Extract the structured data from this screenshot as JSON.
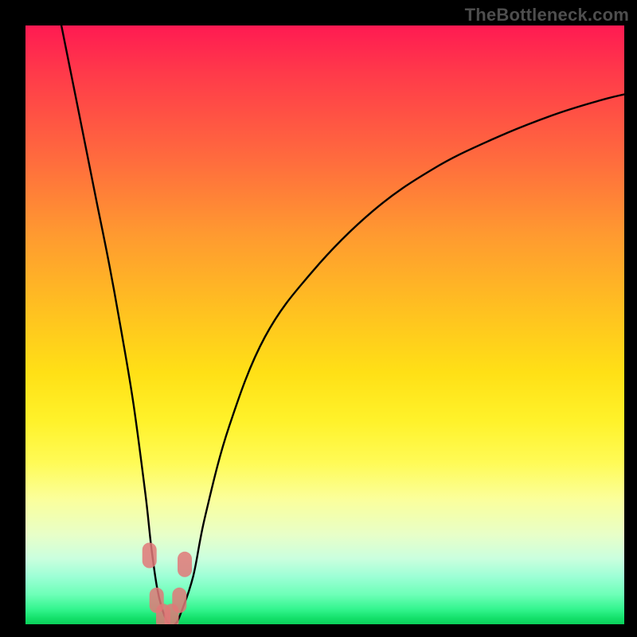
{
  "watermark": "TheBottleneck.com",
  "chart_data": {
    "type": "line",
    "title": "",
    "xlabel": "",
    "ylabel": "",
    "xlim": [
      0,
      100
    ],
    "ylim": [
      0,
      100
    ],
    "grid": false,
    "series": [
      {
        "name": "bottleneck-curve",
        "x": [
          6,
          8,
          10,
          12,
          14,
          16,
          18,
          20,
          21,
          22,
          23,
          24,
          25,
          26,
          28,
          30,
          34,
          40,
          48,
          58,
          68,
          78,
          88,
          96,
          100
        ],
        "values": [
          100,
          90,
          80,
          70,
          60,
          49,
          37,
          22,
          13,
          6,
          2,
          0,
          0,
          2,
          8,
          18,
          33,
          48,
          59,
          69,
          76,
          81,
          85,
          87.5,
          88.5
        ]
      }
    ],
    "marker_points": {
      "x": [
        20.7,
        21.9,
        23.0,
        24.4,
        25.7,
        26.6
      ],
      "values": [
        11.5,
        4.0,
        1.3,
        1.3,
        4.0,
        10.0
      ]
    },
    "gradient_stops": [
      {
        "pos": 0.0,
        "color": "#ff1a52"
      },
      {
        "pos": 0.35,
        "color": "#ff9a30"
      },
      {
        "pos": 0.66,
        "color": "#fff22a"
      },
      {
        "pos": 0.92,
        "color": "#9dffd6"
      },
      {
        "pos": 1.0,
        "color": "#0bd05a"
      }
    ]
  }
}
